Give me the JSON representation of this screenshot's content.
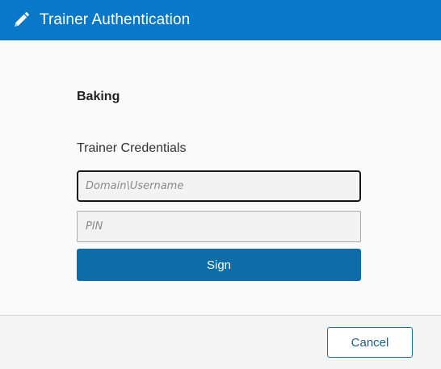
{
  "window": {
    "title": "Trainer Authentication",
    "title_icon": "pencil-icon",
    "accent_color": "#0a78c8"
  },
  "main": {
    "course_name": "Baking",
    "credentials_label": "Trainer Credentials",
    "username_placeholder": "Domain\\Username",
    "username_value": "",
    "pin_placeholder": "PIN",
    "pin_value": "",
    "sign_label": "Sign",
    "sign_color": "#0e6da8"
  },
  "footer": {
    "cancel_label": "Cancel"
  }
}
